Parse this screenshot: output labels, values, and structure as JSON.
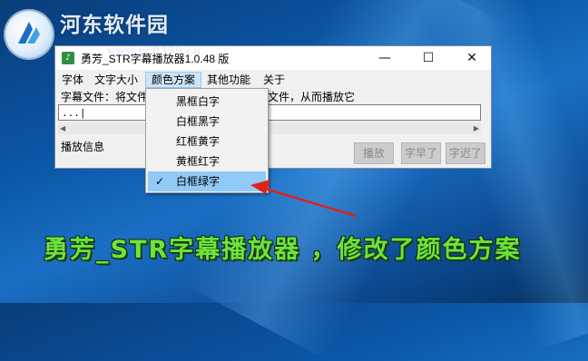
{
  "watermark": {
    "site_name": "河东软件园",
    "url": "www.pc0359.cn"
  },
  "window": {
    "title": "勇芳_STR字幕播放器1.0.48 版",
    "controls": {
      "minimize": "—",
      "maximize": "☐",
      "close": "✕"
    },
    "menu": [
      "字体",
      "文字大小",
      "颜色方案",
      "其他功能",
      "关于"
    ],
    "subtitle_label": "字幕文件：将文件拖拽到此处可以加载字幕文件，从而播放它",
    "subtitle_input_value": "...|",
    "scroll": {
      "left": "◀",
      "right": "▶"
    },
    "info_label": "播放信息",
    "buttons": {
      "play": "播放",
      "earlier": "字早了",
      "later": "字迟了"
    }
  },
  "color_scheme_menu": {
    "items": [
      "黑框白字",
      "白框黑字",
      "红框黄字",
      "黄框红字",
      "白框绿字"
    ],
    "selected_index": 4,
    "check_mark": "✓"
  },
  "caption": "勇芳_STR字幕播放器 ，修改了颜色方案",
  "colors": {
    "caption_green": "#6de33c",
    "arrow_red": "#e0201a",
    "selection_blue": "#91c9f7",
    "open_menu_highlight": "#cce4f7"
  }
}
